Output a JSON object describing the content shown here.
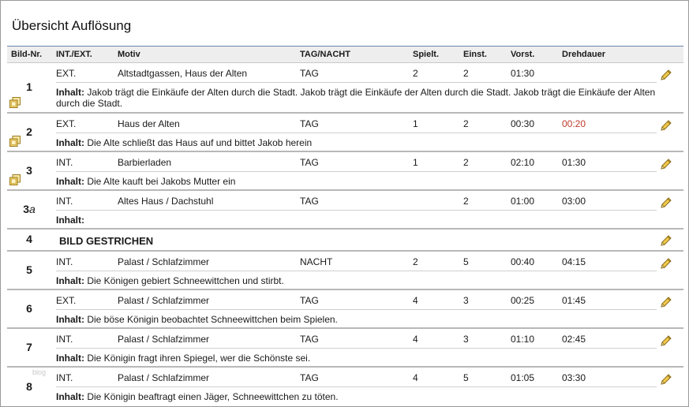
{
  "page": {
    "title": "Übersicht Auflösung",
    "watermark": "blog"
  },
  "columns": {
    "bild_nr": "Bild-Nr.",
    "int_ext": "INT./EXT.",
    "motiv": "Motiv",
    "tag_nacht": "TAG/NACHT",
    "spielt": "Spielt.",
    "einst": "Einst.",
    "vorst": "Vorst.",
    "drehdauer": "Drehdauer"
  },
  "inhalt_label": "Inhalt:",
  "rows": [
    {
      "nr": "1",
      "int_ext": "EXT.",
      "motiv": "Altstadtgassen, Haus der Alten",
      "tag_nacht": "TAG",
      "spielt": "2",
      "einst": "2",
      "vorst": "01:30",
      "drehdauer": "",
      "inhalt": "Jakob trägt die Einkäufe der Alten durch die Stadt. Jakob trägt die Einkäufe der Alten durch die Stadt. Jakob trägt die Einkäufe der Alten durch die Stadt."
    },
    {
      "nr": "2",
      "int_ext": "EXT.",
      "motiv": "Haus der Alten",
      "tag_nacht": "TAG",
      "spielt": "1",
      "einst": "2",
      "vorst": "00:30",
      "drehdauer": "00:20",
      "inhalt": "Die Alte schließt das Haus auf und bittet Jakob herein"
    },
    {
      "nr": "3",
      "int_ext": "INT.",
      "motiv": "Barbierladen",
      "tag_nacht": "TAG",
      "spielt": "1",
      "einst": "2",
      "vorst": "02:10",
      "drehdauer": "01:30",
      "inhalt": "Die Alte kauft bei Jakobs Mutter ein"
    },
    {
      "nr": "3",
      "nr_suffix": "a",
      "int_ext": "INT.",
      "motiv": "Altes Haus / Dachstuhl",
      "tag_nacht": "TAG",
      "spielt": "",
      "einst": "2",
      "vorst": "01:00",
      "drehdauer": "03:00",
      "inhalt": ""
    },
    {
      "nr": "4",
      "gestrichen": "BILD GESTRICHEN"
    },
    {
      "nr": "5",
      "int_ext": "INT.",
      "motiv": "Palast / Schlafzimmer",
      "tag_nacht": "NACHT",
      "spielt": "2",
      "einst": "5",
      "vorst": "00:40",
      "drehdauer": "04:15",
      "inhalt": "Die Königen gebiert Schneewittchen und stirbt."
    },
    {
      "nr": "6",
      "int_ext": "EXT.",
      "motiv": "Palast / Schlafzimmer",
      "tag_nacht": "TAG",
      "spielt": "4",
      "einst": "3",
      "vorst": "00:25",
      "drehdauer": "01:45",
      "inhalt": "Die böse Königin beobachtet Schneewittchen beim Spielen."
    },
    {
      "nr": "7",
      "int_ext": "INT.",
      "motiv": "Palast / Schlafzimmer",
      "tag_nacht": "TAG",
      "spielt": "4",
      "einst": "3",
      "vorst": "01:10",
      "drehdauer": "02:45",
      "inhalt": "Die Königin fragt ihren Spiegel, wer die Schönste sei."
    },
    {
      "nr": "8",
      "int_ext": "INT.",
      "motiv": "Palast / Schlafzimmer",
      "tag_nacht": "TAG",
      "spielt": "4",
      "einst": "5",
      "vorst": "01:05",
      "drehdauer": "03:30",
      "inhalt": "Die Königin beaftragt einen Jäger, Schneewittchen zu töten."
    }
  ],
  "colors": {
    "header_line": "#6a85b0",
    "highlight_red": "#c0392b",
    "pencil": "#e8b731"
  },
  "icons": {
    "edit": "pencil-icon",
    "copy": "copy-icon"
  }
}
